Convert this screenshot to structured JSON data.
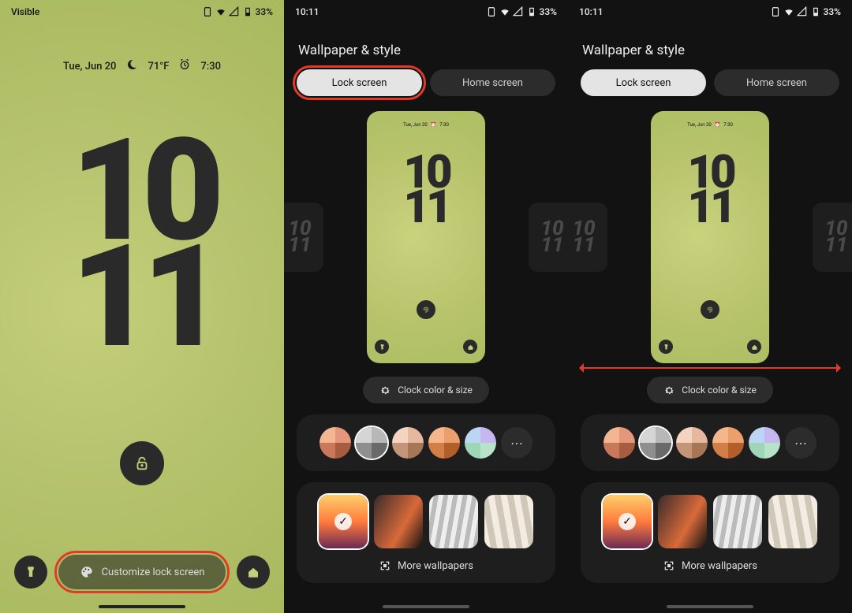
{
  "panel1": {
    "carrier": "Visible",
    "battery": "33%",
    "date": "Tue, Jun 20",
    "temp": "71°F",
    "alarm": "7:30",
    "clock_hour": "10",
    "clock_min": "11",
    "customize_label": "Customize lock screen"
  },
  "panel2": {
    "time": "10:11",
    "battery": "33%",
    "title": "Wallpaper & style",
    "tab_lock": "Lock screen",
    "tab_home": "Home screen",
    "preview_date": "Tue, Jun 20",
    "preview_alarm": "7:30",
    "preview_hour": "10",
    "preview_min": "11",
    "side_hour": "10",
    "side_min": "11",
    "clock_size_label": "Clock color & size",
    "more_wall_label": "More wallpapers",
    "swatches": [
      {
        "q1": "#f2b692",
        "q2": "#e4977a",
        "q3": "#c97959",
        "q4": "#a85d40"
      },
      {
        "q1": "#d5d5d5",
        "q2": "#b8b8b8",
        "q3": "#8f8f8f",
        "q4": "#6a6a6a"
      },
      {
        "q1": "#f4d4c1",
        "q2": "#e7b8a0",
        "q3": "#c59579",
        "q4": "#a67657"
      },
      {
        "q1": "#f5b78a",
        "q2": "#eb9f6d",
        "q3": "#d27e47",
        "q4": "#b35f29"
      },
      {
        "q1": "#bcd5f5",
        "q2": "#c7b7f0",
        "q3": "#9ed6b8",
        "q4": "#b8e3cb"
      }
    ]
  },
  "panel3": {
    "time": "10:11",
    "battery": "33%",
    "title": "Wallpaper & style",
    "tab_lock": "Lock screen",
    "tab_home": "Home screen",
    "preview_date": "Tue, Jun 20",
    "preview_alarm": "7:30",
    "preview_hour": "10",
    "preview_min": "11",
    "side_hour": "10",
    "side_min": "11",
    "clock_size_label": "Clock color & size",
    "more_wall_label": "More wallpapers"
  }
}
